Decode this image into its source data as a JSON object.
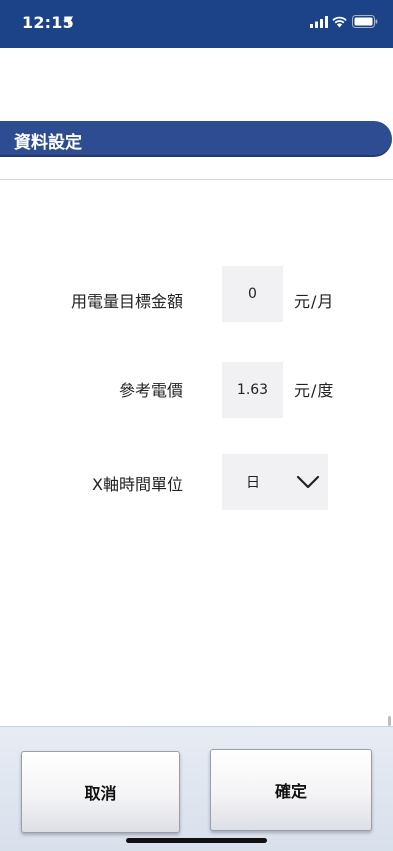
{
  "status_bar": {
    "time": "12:15"
  },
  "section": {
    "title": "資料設定"
  },
  "form": {
    "target_amount": {
      "label": "用電量目標金額",
      "value": "0",
      "unit": "元/月"
    },
    "reference_price": {
      "label": "參考電價",
      "value": "1.63",
      "unit": "元/度"
    },
    "x_axis_unit": {
      "label": "X軸時間單位",
      "selected": "日"
    }
  },
  "footer": {
    "cancel_label": "取消",
    "confirm_label": "確定"
  },
  "colors": {
    "header_blue": "#1c4388",
    "section_blue": "#2e4c91",
    "field_bg": "#f1f1f4"
  }
}
